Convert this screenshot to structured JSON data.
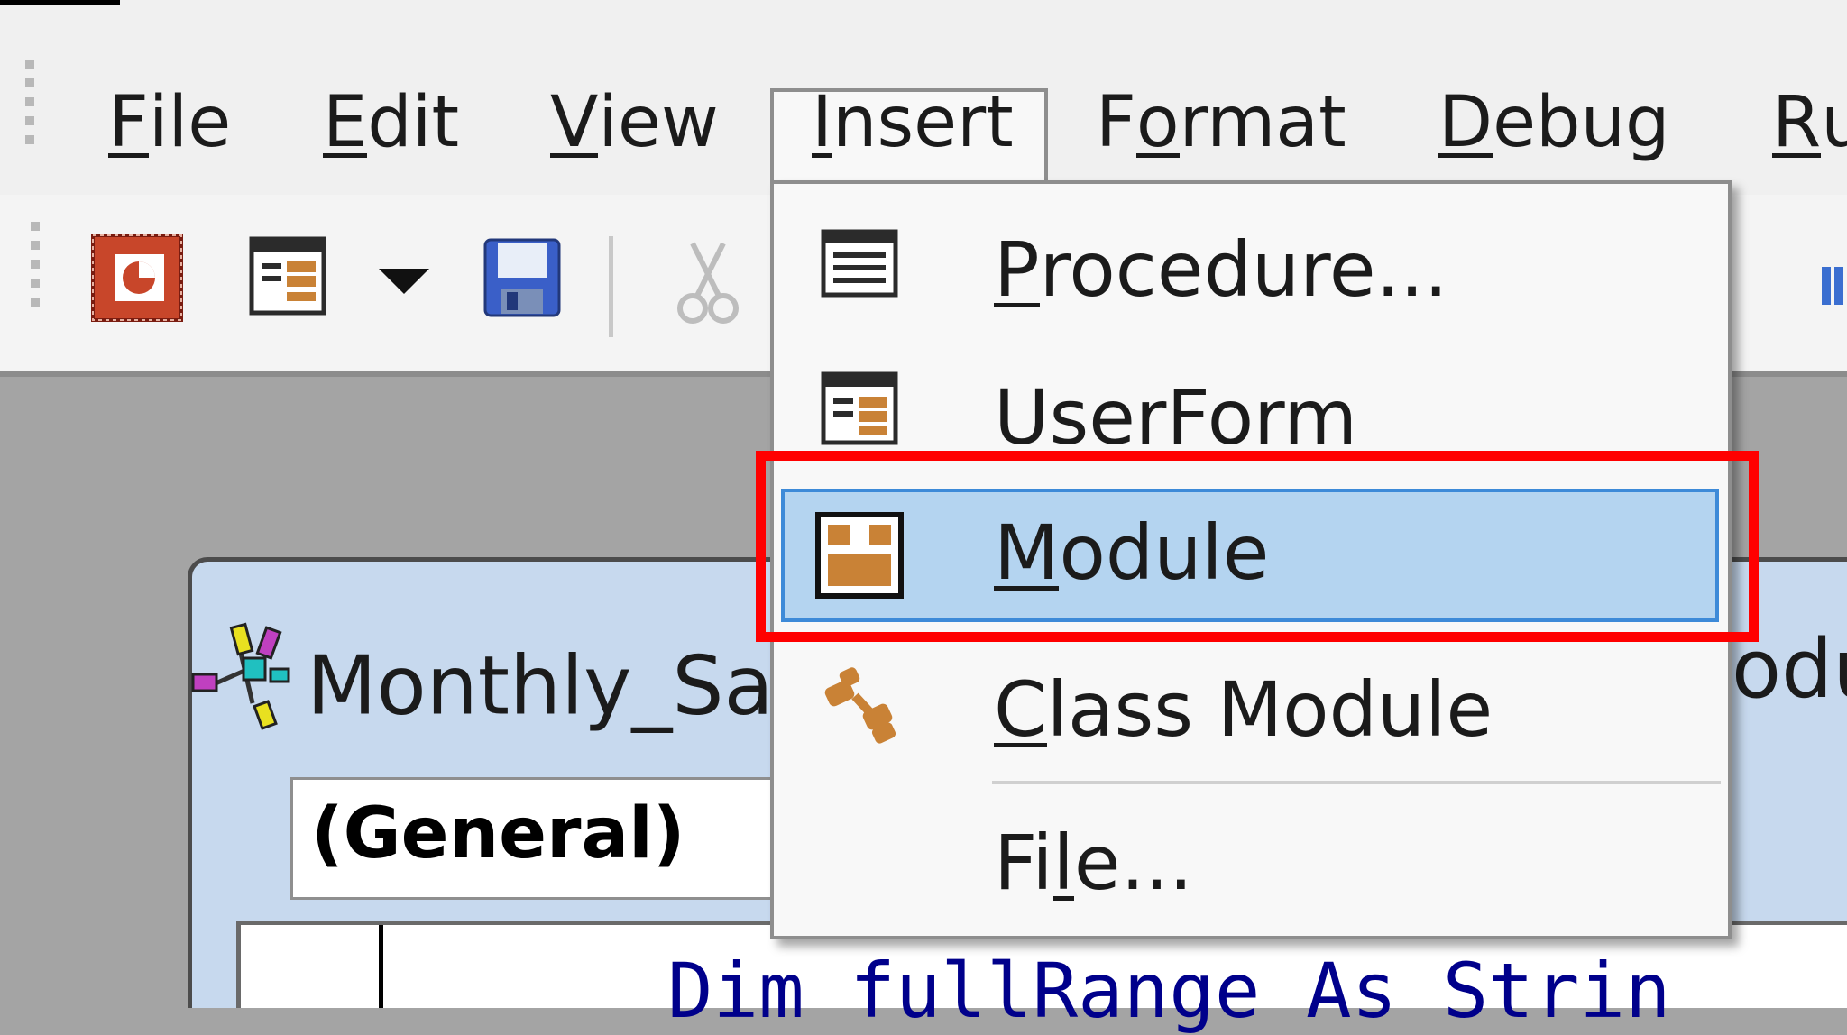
{
  "menubar": {
    "items": [
      {
        "key": "F",
        "rest": "ile"
      },
      {
        "key": "E",
        "rest": "dit"
      },
      {
        "key": "V",
        "rest": "iew"
      },
      {
        "key": "I",
        "rest": "nsert"
      },
      {
        "pre": "F",
        "key": "o",
        "rest": "rmat"
      },
      {
        "key": "D",
        "rest": "ebug"
      },
      {
        "key": "R",
        "rest": "u"
      }
    ],
    "open_menu": "Insert"
  },
  "toolbar": {
    "buttons": [
      "powerpoint-icon",
      "userform-icon",
      "dropdown-arrow-icon",
      "save-icon",
      "cut-icon"
    ]
  },
  "insert_menu": {
    "items": [
      {
        "key": "P",
        "rest": "rocedure..."
      },
      {
        "pre": "",
        "key": "",
        "rest": "UserForm"
      },
      {
        "key": "M",
        "rest": "odule"
      },
      {
        "key": "C",
        "rest": "lass Module"
      },
      {
        "pre": "Fi",
        "key": "l",
        "rest": "e..."
      }
    ],
    "highlighted": "Module"
  },
  "code_window": {
    "title_visible": "Monthly_Sa",
    "title_tail_visible": "odul",
    "object_combo": "(General)",
    "code_line": "Dim fullRange As Strin"
  },
  "colors": {
    "highlight": "#b4d4f0",
    "highlight_border": "#3d8ad8",
    "annotation": "#ff0000"
  }
}
